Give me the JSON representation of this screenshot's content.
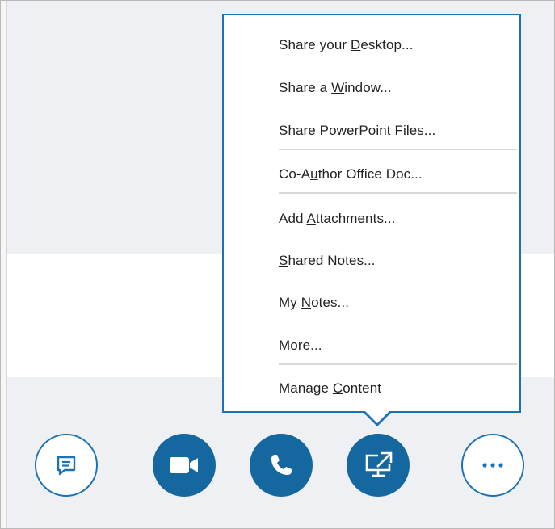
{
  "share_menu": {
    "items": [
      {
        "pre": "Share your ",
        "accel": "D",
        "post": "esktop..."
      },
      {
        "pre": "Share a ",
        "accel": "W",
        "post": "indow..."
      },
      {
        "pre": "Share PowerPoint ",
        "accel": "F",
        "post": "iles..."
      },
      {
        "pre": "Co-A",
        "accel": "u",
        "post": "thor Office Doc..."
      },
      {
        "pre": "Add ",
        "accel": "A",
        "post": "ttachments..."
      },
      {
        "pre": "",
        "accel": "S",
        "post": "hared Notes..."
      },
      {
        "pre": "My ",
        "accel": "N",
        "post": "otes..."
      },
      {
        "pre": "",
        "accel": "M",
        "post": "ore..."
      },
      {
        "pre": "Manage ",
        "accel": "C",
        "post": "ontent"
      }
    ]
  },
  "toolbar": {
    "buttons": [
      {
        "name": "im-button",
        "icon": "chat-bubble-icon",
        "style": "outline"
      },
      {
        "name": "video-button",
        "icon": "video-camera-icon",
        "style": "filled"
      },
      {
        "name": "call-button",
        "icon": "phone-icon",
        "style": "filled"
      },
      {
        "name": "present-button",
        "icon": "share-screen-icon",
        "style": "filled"
      },
      {
        "name": "more-options-button",
        "icon": "ellipsis-icon",
        "style": "outline"
      }
    ]
  },
  "colors": {
    "accent": "#1b73b5",
    "button_fill": "#15679f",
    "background": "#eef0f3"
  }
}
